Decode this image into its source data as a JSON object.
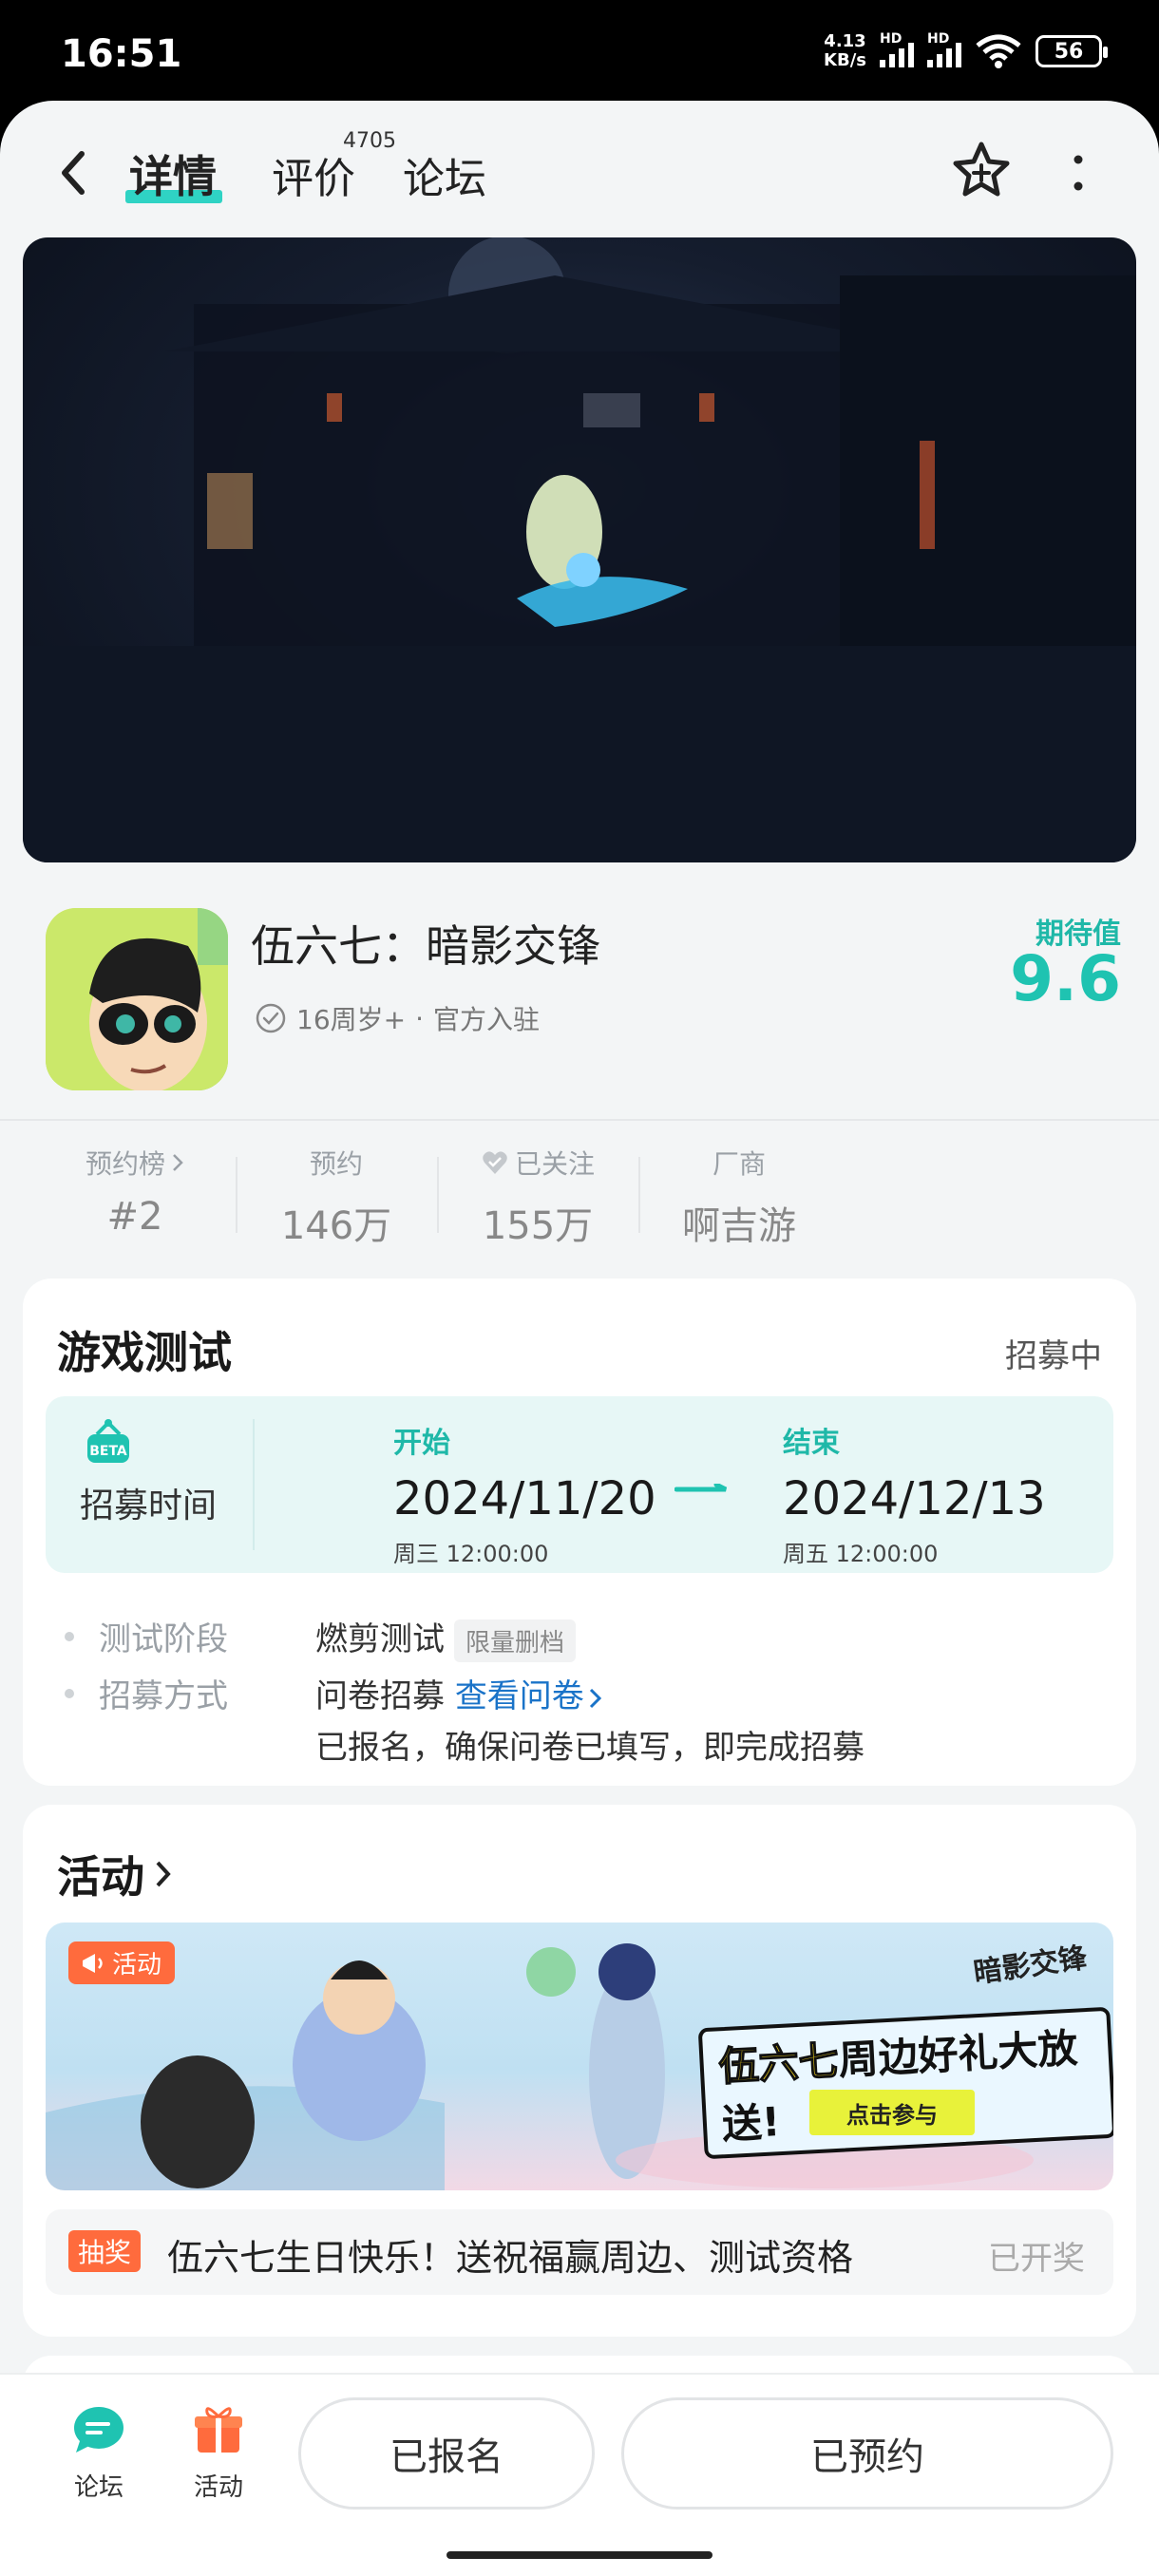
{
  "status_bar": {
    "time": "16:51",
    "net_speed_value": "4.13",
    "net_speed_unit": "KB/s",
    "signal_1_label": "HD",
    "signal_2_label": "HD",
    "battery": "56"
  },
  "header": {
    "tabs": [
      {
        "label": "详情",
        "active": true
      },
      {
        "label": "评价"
      },
      {
        "label": "论坛"
      }
    ],
    "review_count": "4705",
    "icons": [
      "back-icon",
      "star-icon",
      "more-icon"
    ]
  },
  "game": {
    "title": "伍六七：暗影交锋",
    "age_rating": "16周岁+",
    "separator": "·",
    "official": "官方入驻",
    "score_label": "期待值",
    "score": "9.6"
  },
  "stats": [
    {
      "label": "预约榜",
      "value": "#2",
      "has_chevron": true
    },
    {
      "label": "预约",
      "value": "146万"
    },
    {
      "label": "已关注",
      "value": "155万",
      "has_heart": true
    },
    {
      "label": "厂商",
      "value": "啊吉游"
    }
  ],
  "test_card": {
    "title": "游戏测试",
    "status": "招募中",
    "recruit_time_label": "招募时间",
    "start": {
      "label": "开始",
      "date": "2024/11/20",
      "weekday_time": "周三  12:00:00"
    },
    "end": {
      "label": "结束",
      "date": "2024/12/13",
      "weekday_time": "周五  12:00:00"
    },
    "phase_label": "测试阶段",
    "phase_value": "燃剪测试",
    "phase_tag": "限量删档",
    "method_label": "招募方式",
    "method_value": "问卷招募",
    "method_link": "查看问卷",
    "method_note": "已报名，确保问卷已填写，即完成招募"
  },
  "activity_card": {
    "title": "活动",
    "banner_badge": "活动",
    "banner_brand": "暗影交锋",
    "banner_slogan_highlight": "伍六七",
    "banner_slogan_rest": "周边好礼大放送!",
    "banner_cta": "点击参与",
    "lottery_tag": "抽奖",
    "lottery_text": "伍六七生日快乐！送祝福赢周边、测试资格",
    "lottery_status": "已开奖"
  },
  "bottom_bar": {
    "forum_label": "论坛",
    "activity_label": "活动",
    "signed_up_button": "已报名",
    "reserved_button": "已预约"
  },
  "colors": {
    "accent": "#1fc3b1",
    "orange": "#ff6b3d",
    "link": "#1a73c8"
  }
}
